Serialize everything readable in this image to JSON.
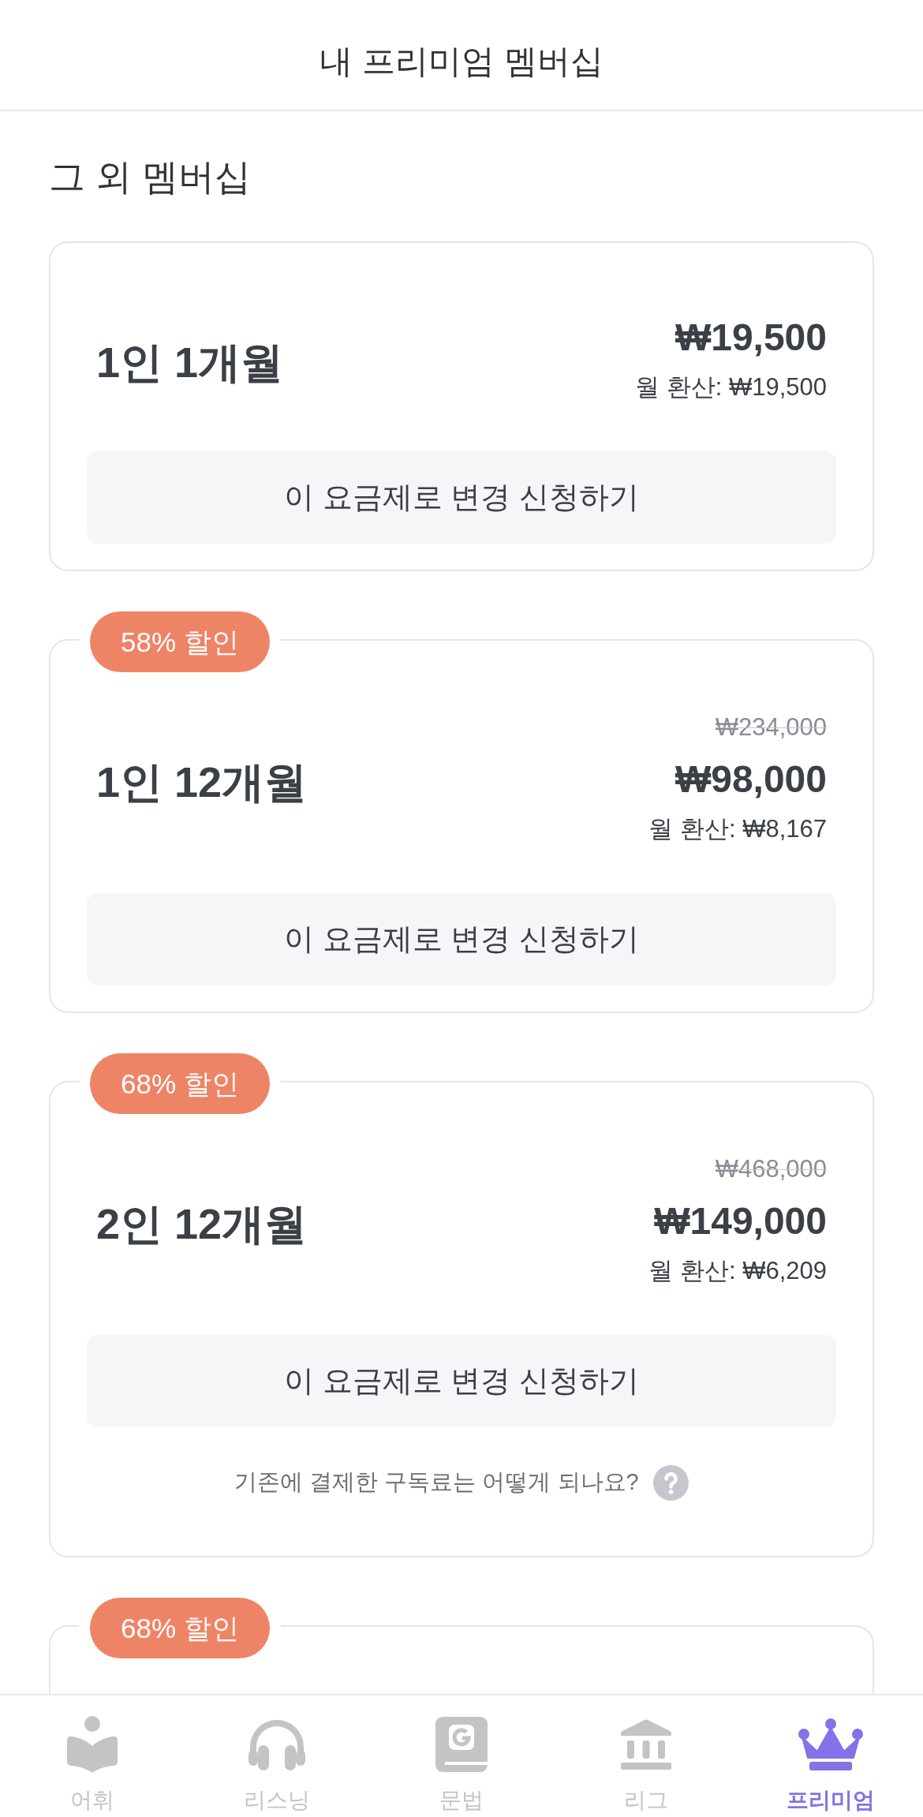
{
  "header": {
    "title": "내 프리미엄 멤버십"
  },
  "section": {
    "title": "그 외 멤버십"
  },
  "plans": [
    {
      "name": "1인 1개월",
      "price": "₩19,500",
      "monthly": "월 환산: ₩19,500",
      "button": "이 요금제로 변경 신청하기"
    },
    {
      "badge": "58% 할인",
      "name": "1인 12개월",
      "original_price": "₩234,000",
      "price": "₩98,000",
      "monthly": "월 환산: ₩8,167",
      "button": "이 요금제로 변경 신청하기"
    },
    {
      "badge": "68% 할인",
      "name": "2인 12개월",
      "original_price": "₩468,000",
      "price": "₩149,000",
      "monthly": "월 환산: ₩6,209",
      "button": "이 요금제로 변경 신청하기",
      "help_text": "기존에 결제한 구독료는 어떻게 되나요?"
    },
    {
      "badge": "68% 할인"
    }
  ],
  "tabs": [
    {
      "label": "어휘",
      "kind": "reader",
      "selected": false
    },
    {
      "label": "리스닝",
      "kind": "headphones",
      "selected": false
    },
    {
      "label": "문법",
      "kind": "book",
      "selected": false
    },
    {
      "label": "리그",
      "kind": "building",
      "selected": false
    },
    {
      "label": "프리미엄",
      "kind": "crown",
      "selected": true
    }
  ]
}
